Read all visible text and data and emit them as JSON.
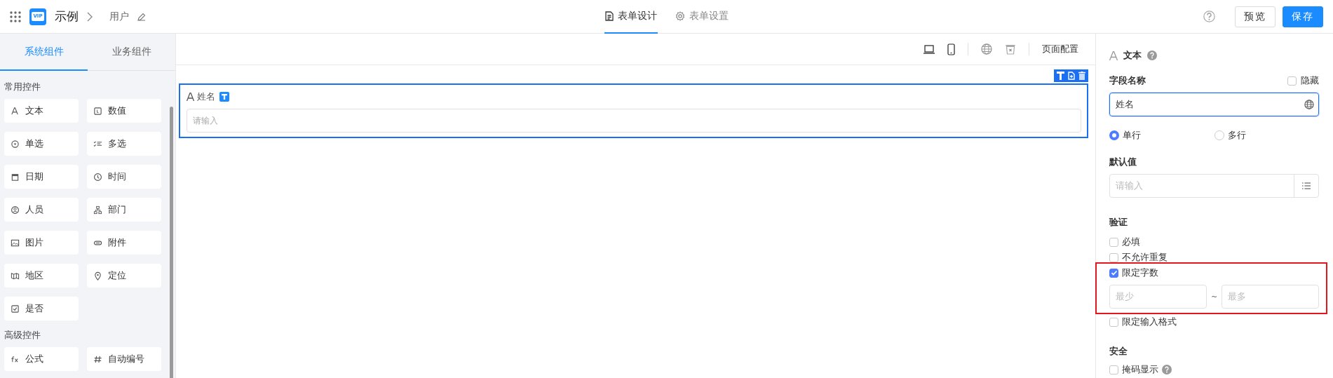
{
  "header": {
    "logo_text": "VIP",
    "app_name": "示例",
    "breadcrumb": "用户",
    "tabs": [
      {
        "label": "表单设计",
        "selected": true
      },
      {
        "label": "表单设置",
        "selected": false
      }
    ],
    "buttons": [
      {
        "label": "预览",
        "kind": "secondary"
      },
      {
        "label": "保存",
        "kind": "primary"
      }
    ]
  },
  "sidebar": {
    "tabs": [
      {
        "label": "系统组件",
        "selected": true
      },
      {
        "label": "业务组件",
        "selected": false
      }
    ],
    "groups": [
      {
        "title": "常用控件",
        "items": [
          "文本",
          "数值",
          "单选",
          "多选",
          "日期",
          "时间",
          "人员",
          "部门",
          "图片",
          "附件",
          "地区",
          "定位",
          "是否"
        ]
      },
      {
        "title": "高级控件",
        "items": [
          "公式",
          "自动编号"
        ]
      }
    ]
  },
  "canvas": {
    "toolbar_label": "页面配置",
    "fields": [
      {
        "label": "姓名",
        "placeholder": "请输入",
        "selected": true
      }
    ]
  },
  "properties": {
    "title": "文本",
    "field_name": {
      "label": "字段名称",
      "hidden_label": "隐藏",
      "hidden": false,
      "value": "姓名"
    },
    "line_modes": [
      {
        "label": "单行",
        "selected": true
      },
      {
        "label": "多行",
        "selected": false
      }
    ],
    "default_value": {
      "label": "默认值",
      "placeholder": "请输入"
    },
    "validation": {
      "label": "验证",
      "rules": [
        {
          "label": "必填",
          "checked": false
        },
        {
          "label": "不允许重复",
          "checked": false
        },
        {
          "label": "限定字数",
          "checked": true,
          "highlighted": true,
          "min_placeholder": "最少",
          "separator": "~",
          "max_placeholder": "最多"
        },
        {
          "label": "限定输入格式",
          "checked": false
        }
      ]
    },
    "security": {
      "label": "安全",
      "rules": [
        {
          "label": "掩码显示",
          "checked": false,
          "help": true
        }
      ]
    }
  }
}
